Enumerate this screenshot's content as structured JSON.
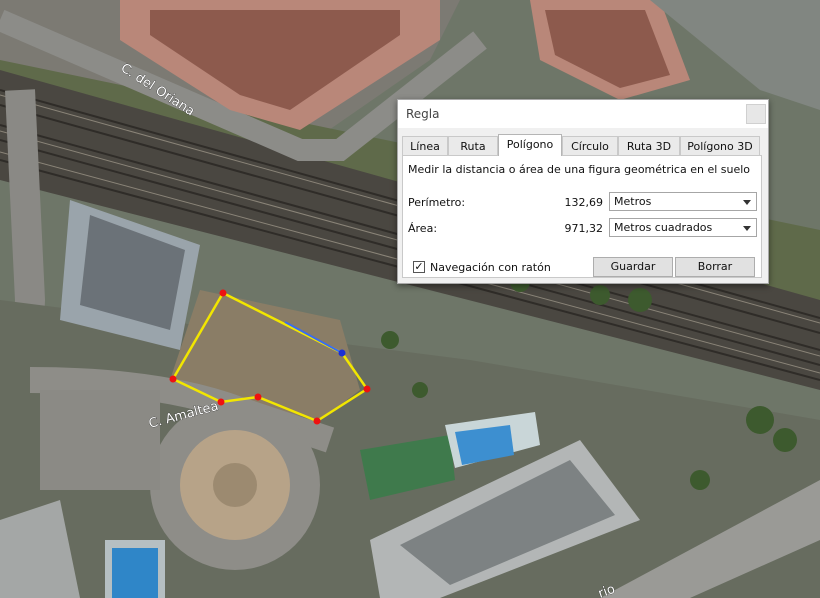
{
  "map": {
    "streets": [
      "C. del Oriana",
      "C. Amaltea",
      "rio"
    ]
  },
  "dialog": {
    "title": "Regla",
    "tabs": [
      "Línea",
      "Ruta",
      "Polígono",
      "Círculo",
      "Ruta 3D",
      "Polígono 3D"
    ],
    "active_tab": "Polígono",
    "description": "Medir la distancia o área de una figura geométrica en el suelo",
    "perimeter": {
      "label": "Perímetro:",
      "value": "132,69",
      "unit": "Metros"
    },
    "area": {
      "label": "Área:",
      "value": "971,32",
      "unit": "Metros cuadrados"
    },
    "mouse_nav": {
      "label": "Navegación con ratón",
      "checked": true,
      "mark": "✓"
    },
    "save_label": "Guardar",
    "clear_label": "Borrar"
  }
}
